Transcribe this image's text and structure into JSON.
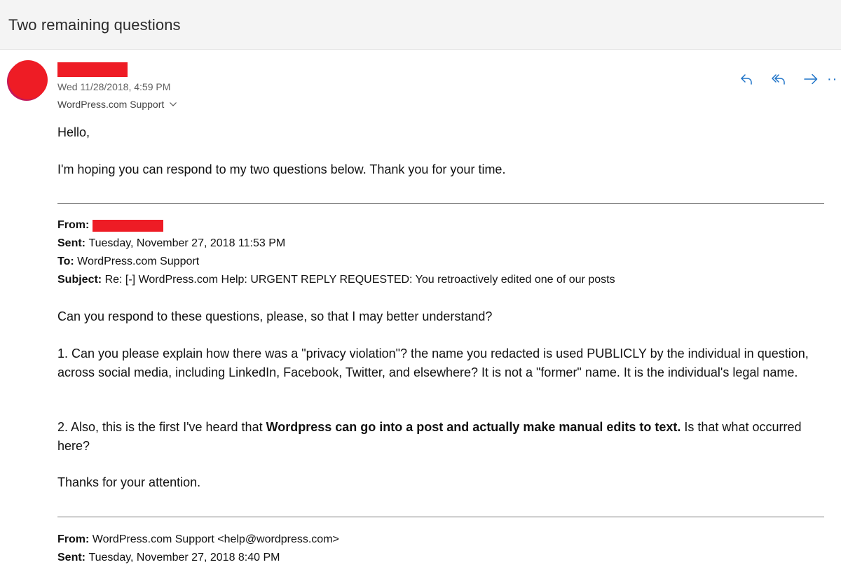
{
  "subject": "Two remaining questions",
  "message": {
    "date": "Wed 11/28/2018, 4:59 PM",
    "to": "WordPress.com Support",
    "greeting": "Hello,",
    "intro": "I'm hoping you can respond to my two questions below. Thank you for your time."
  },
  "actions": {
    "reply_icon": "reply-icon",
    "reply_all_icon": "reply-all-icon",
    "forward_icon": "forward-icon",
    "more_icon": "more-icon",
    "more_label": "··"
  },
  "quoted1": {
    "from_label": "From:",
    "sent_label": "Sent:",
    "sent": "Tuesday, November 27, 2018 11:53 PM",
    "to_label": "To:",
    "to": "WordPress.com Support",
    "subject_label": "Subject:",
    "subject": "Re: [-] WordPress.com Help: URGENT REPLY REQUESTED: You retroactively edited one of our posts",
    "ask": "Can you respond to these questions, please, so that I may better understand?",
    "q1": "1. Can you please explain how there was a \"privacy violation\"? the name you redacted is used PUBLICLY by the individual in question, across social media, including LinkedIn, Facebook, Twitter, and elsewhere? It is not a \"former\" name. It is the individual's legal name.",
    "q2_prefix": "2. Also, this is the first I've heard that ",
    "q2_bold": "Wordpress can go into a post and actually make manual edits to text.",
    "q2_suffix": " Is that what occurred here?",
    "thanks": "Thanks for your attention."
  },
  "quoted2": {
    "from_label": "From:",
    "from": "WordPress.com Support <help@wordpress.com>",
    "sent_label": "Sent:",
    "sent": "Tuesday, November 27, 2018 8:40 PM"
  },
  "colors": {
    "redaction": "#ee1c25",
    "accent": "#1e73c8",
    "header_bg": "#f4f4f4"
  }
}
